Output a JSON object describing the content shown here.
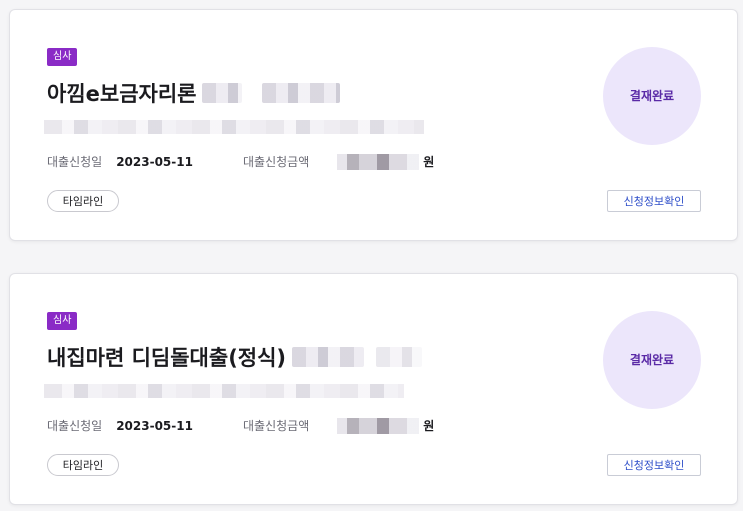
{
  "cards": [
    {
      "badge": "심사",
      "title": "아낌e보금자리론",
      "apply_date_label": "대출신청일",
      "apply_date": "2023-05-11",
      "amount_label": "대출신청금액",
      "amount_unit": "원",
      "timeline_label": "타임라인",
      "status": "결재완료",
      "detail_label": "신청정보확인"
    },
    {
      "badge": "심사",
      "title": "내집마련 디딤돌대출(정식)",
      "apply_date_label": "대출신청일",
      "apply_date": "2023-05-11",
      "amount_label": "대출신청금액",
      "amount_unit": "원",
      "timeline_label": "타임라인",
      "status": "결재완료",
      "detail_label": "신청정보확인"
    }
  ],
  "colors": {
    "badge_bg": "#8a2bc6",
    "status_circle_bg": "#ece6fb",
    "status_text": "#5a2aa6",
    "detail_text": "#2f4fc9"
  }
}
